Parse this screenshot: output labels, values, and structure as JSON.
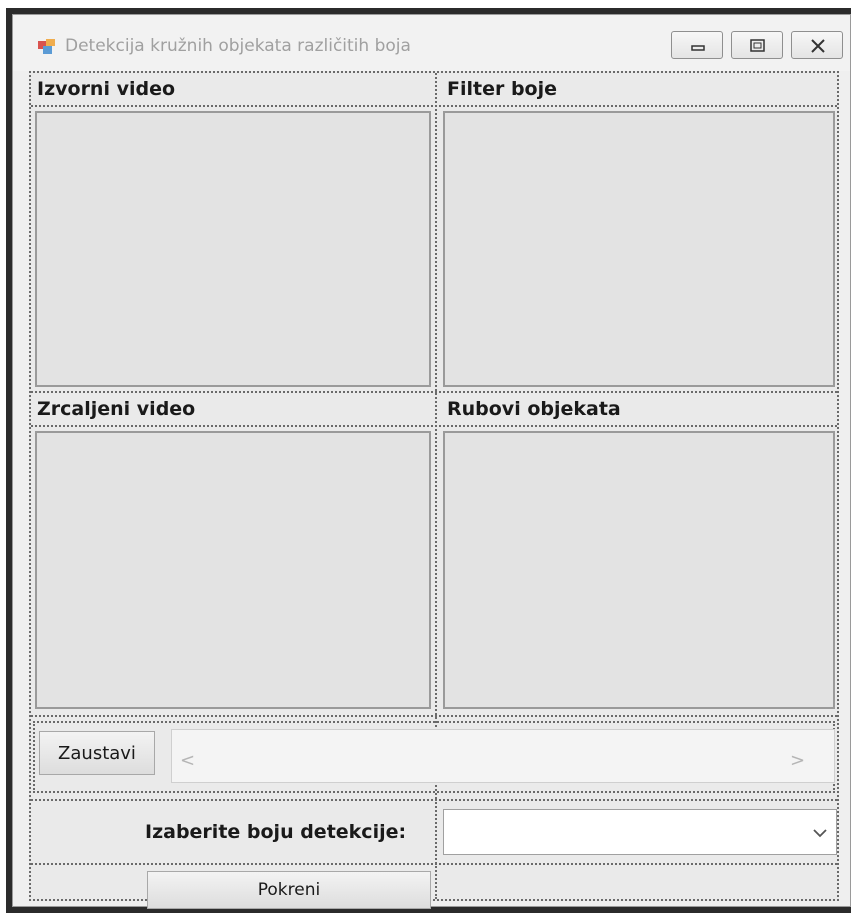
{
  "window": {
    "title": "Detekcija kružnih objekata različitih boja",
    "controls": [
      "minimize-icon",
      "maximize-icon",
      "close-icon"
    ]
  },
  "panels": {
    "source_video": {
      "label": "Izvorni video"
    },
    "color_filter": {
      "label": "Filter boje"
    },
    "mirrored_video": {
      "label": "Zrcaljeni video"
    },
    "object_edges": {
      "label": "Rubovi objekata"
    }
  },
  "controls": {
    "stop_label": "Zaustavi",
    "scroll_left": "<",
    "scroll_right": ">",
    "color_select_label": "Izaberite boju  detekcije:",
    "color_select_value": "",
    "start_label": "Pokreni"
  },
  "colors": {
    "window_bg": "#efefef",
    "picture_bg": "#e3e3e3",
    "title_text": "#a0a0a0"
  }
}
